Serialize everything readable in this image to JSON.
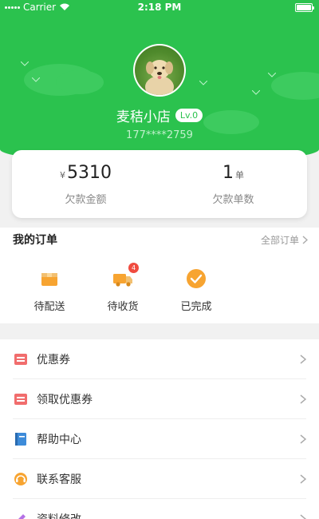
{
  "status_bar": {
    "carrier": "Carrier",
    "time": "2:18 PM"
  },
  "profile": {
    "store_name": "麦秸小店",
    "level": "Lv.0",
    "phone": "177****2759",
    "avatar_icon": "dog-photo-avatar"
  },
  "summary": {
    "amount": {
      "currency": "¥",
      "value": "5310",
      "label": "欠款金额"
    },
    "count": {
      "value": "1",
      "unit": "单",
      "label": "欠款单数"
    }
  },
  "orders": {
    "title": "我的订单",
    "all_label": "全部订单",
    "items": [
      {
        "label": "待配送",
        "icon": "box-icon"
      },
      {
        "label": "待收货",
        "icon": "truck-icon",
        "badge": "4"
      },
      {
        "label": "已完成",
        "icon": "check-circle-icon"
      }
    ]
  },
  "menu": {
    "items": [
      {
        "label": "优惠券",
        "icon": "coupon-icon"
      },
      {
        "label": "领取优惠券",
        "icon": "coupon-icon"
      },
      {
        "label": "帮助中心",
        "icon": "book-icon"
      },
      {
        "label": "联系客服",
        "icon": "headset-icon"
      },
      {
        "label": "资料修改",
        "icon": "edit-icon"
      }
    ]
  },
  "colors": {
    "primary": "#2bc24e",
    "accent_orange": "#f7a431",
    "coupon_red": "#f16d6d",
    "help_blue": "#3d8bd9"
  }
}
